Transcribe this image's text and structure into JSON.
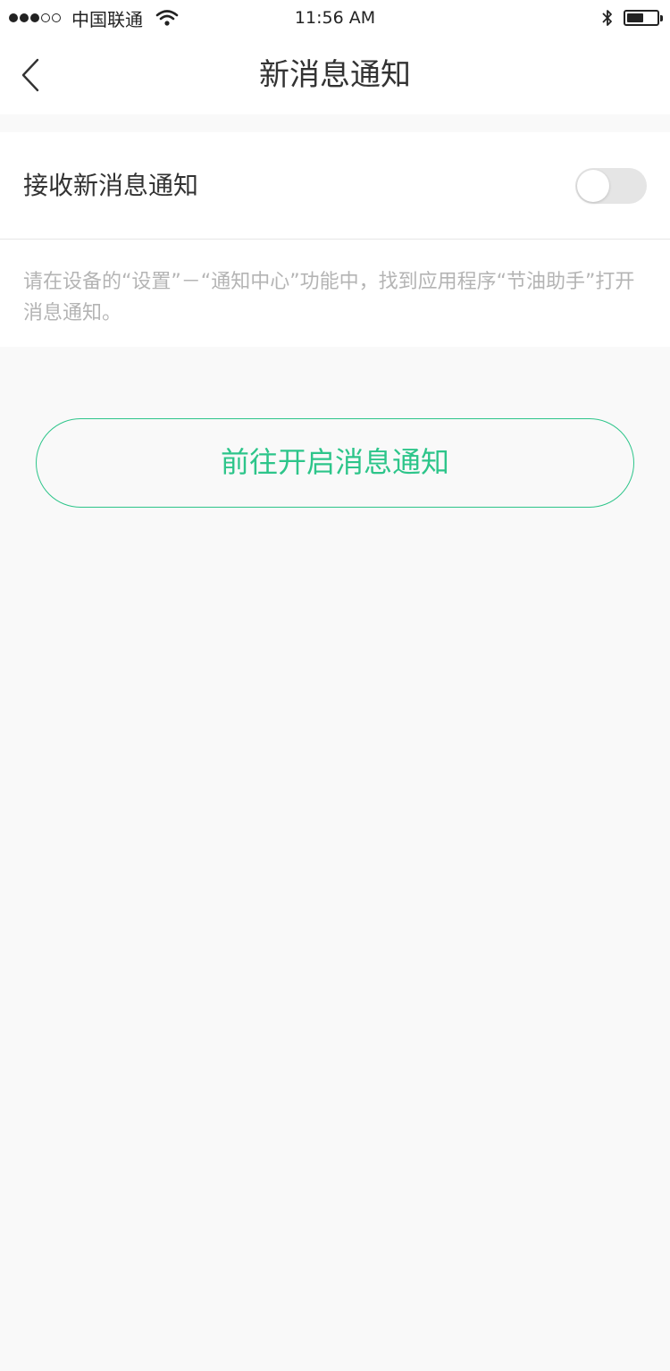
{
  "status_bar": {
    "carrier": "中国联通",
    "time": "11:56 AM",
    "signal_bars_filled": 3,
    "signal_bars_total": 5,
    "battery_level": 0.55
  },
  "nav": {
    "title": "新消息通知",
    "back_icon": "chevron-left-icon"
  },
  "settings": {
    "notification_toggle_label": "接收新消息通知",
    "notification_toggle_on": false,
    "hint": "请在设备的“设置”－“通知中心”功能中，找到应用程序“节油助手”打开消息通知。"
  },
  "cta": {
    "label": "前往开启消息通知"
  },
  "colors": {
    "accent": "#2dc58a",
    "background": "#f9f9f9",
    "card": "#ffffff",
    "hint_text": "#b4b4b4",
    "toggle_off": "#e5e5e5"
  }
}
